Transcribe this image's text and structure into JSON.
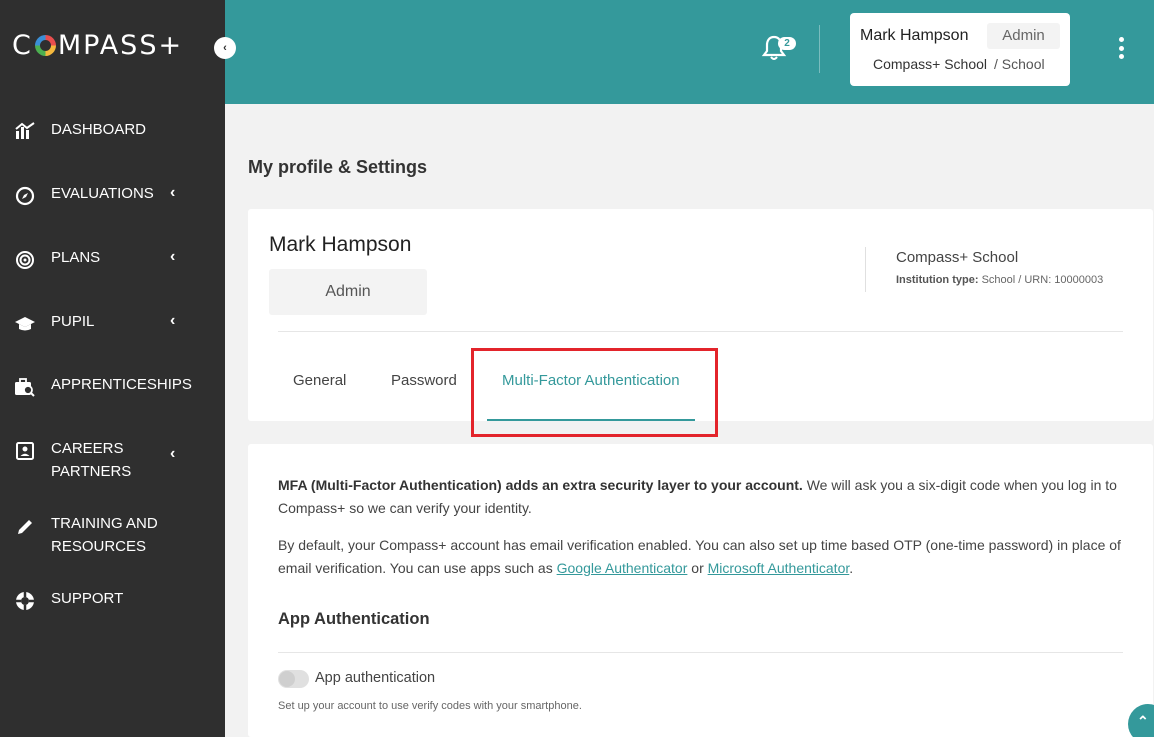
{
  "brand": {
    "name": "COMPASS+"
  },
  "sidebar": {
    "items": [
      {
        "label": "DASHBOARD",
        "icon": "chart-icon"
      },
      {
        "label": "EVALUATIONS",
        "icon": "compass-icon"
      },
      {
        "label": "PLANS",
        "icon": "target-icon"
      },
      {
        "label": "PUPIL",
        "icon": "graduation-cap-icon"
      },
      {
        "label": "APPRENTICESHIPS",
        "icon": "briefcase-search-icon"
      },
      {
        "label": "CAREERS PARTNERS",
        "icon": "contact-card-icon"
      },
      {
        "label": "TRAINING AND RESOURCES",
        "icon": "pencil-icon"
      },
      {
        "label": "SUPPORT",
        "icon": "lifebuoy-icon"
      }
    ]
  },
  "header": {
    "notifications_count": "2",
    "user": {
      "name": "Mark Hampson",
      "role": "Admin",
      "school": "Compass+ School",
      "type": "/ School"
    }
  },
  "page": {
    "title": "My profile & Settings"
  },
  "profile": {
    "name": "Mark Hampson",
    "role": "Admin",
    "school": "Compass+ School",
    "inst_type_label": "Institution type:",
    "inst_type_value": "School / URN: 10000003"
  },
  "tabs": [
    {
      "label": "General",
      "active": false
    },
    {
      "label": "Password",
      "active": false
    },
    {
      "label": "Multi-Factor Authentication",
      "active": true
    }
  ],
  "mfa": {
    "intro_bold": "MFA (Multi-Factor Authentication) adds an extra security layer to your account.",
    "intro_rest": " We will ask you a six-digit code when you log in to Compass+ so we can verify your identity.",
    "default_text": "By default, your Compass+ account has email verification enabled. You can also set up time based OTP (one-time password) in place of email verification. You can use apps such as ",
    "link_google": "Google Authenticator",
    "or": " or ",
    "link_microsoft": "Microsoft Authenticator",
    "period": ".",
    "section_title": "App Authentication",
    "toggle_label": "App authentication",
    "toggle_help": "Set up your account to use verify codes with your smartphone.",
    "toggle_on": false
  },
  "colors": {
    "accent": "#34999b",
    "sidebar": "#2f2f2f",
    "highlight": "#e3242b"
  }
}
